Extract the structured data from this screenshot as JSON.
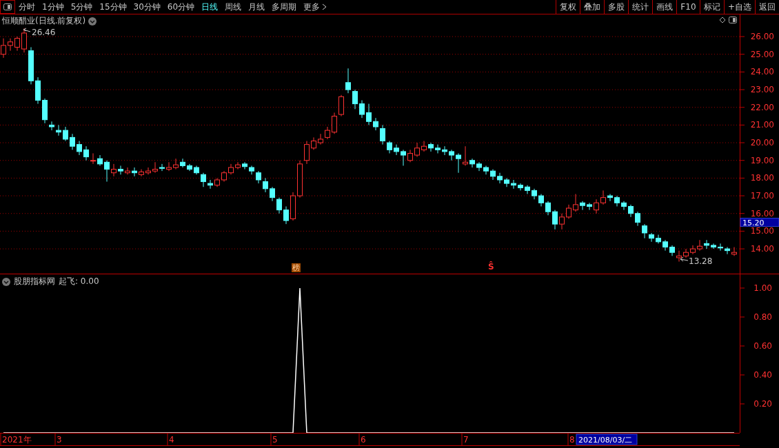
{
  "toolbar": {
    "periods": [
      {
        "label": "分时",
        "kind": "period",
        "selected": false
      },
      {
        "label": "1分钟",
        "kind": "period",
        "selected": false
      },
      {
        "label": "5分钟",
        "kind": "period",
        "selected": false
      },
      {
        "label": "15分钟",
        "kind": "period",
        "selected": false
      },
      {
        "label": "30分钟",
        "kind": "period",
        "selected": false
      },
      {
        "label": "60分钟",
        "kind": "period",
        "selected": false
      },
      {
        "label": "日线",
        "kind": "period",
        "selected": true
      },
      {
        "label": "周线",
        "kind": "period",
        "selected": false
      },
      {
        "label": "月线",
        "kind": "period",
        "selected": false
      },
      {
        "label": "多周期",
        "kind": "period",
        "selected": false
      },
      {
        "label": "更多",
        "kind": "menu",
        "selected": false
      }
    ],
    "actions": [
      "复权",
      "叠加",
      "多股",
      "统计",
      "画线",
      "F10",
      "标记",
      "+自选",
      "返回"
    ]
  },
  "price_pane": {
    "title": "恒顺醋业(日线.前复权)",
    "high_label": "26.46",
    "low_label": "13.28",
    "current_price": "15.20",
    "markers": [
      "榜",
      "Ŝ"
    ],
    "chart_data": {
      "type": "candlestick",
      "grid": true,
      "ylim": [
        12.6,
        27.25
      ],
      "yticks": [
        {
          "value": 26,
          "label": "26.00"
        },
        {
          "value": 25,
          "label": "25.00"
        },
        {
          "value": 24,
          "label": "24.00"
        },
        {
          "value": 23,
          "label": "23.00"
        },
        {
          "value": 22,
          "label": "22.00"
        },
        {
          "value": 21,
          "label": "21.00"
        },
        {
          "value": 20,
          "label": "20.00"
        },
        {
          "value": 19,
          "label": "19.00"
        },
        {
          "value": 18,
          "label": "18.00"
        },
        {
          "value": 17,
          "label": "17.00"
        },
        {
          "value": 16,
          "label": "16.00"
        },
        {
          "value": 15,
          "label": "15.00"
        },
        {
          "value": 14,
          "label": "14.00"
        }
      ],
      "categories": [
        null,
        null,
        null,
        null,
        null,
        null,
        null,
        null,
        null,
        null,
        null,
        null,
        null,
        null,
        null,
        null,
        null,
        null,
        null,
        null,
        null,
        null,
        null,
        null,
        null,
        null,
        null,
        null,
        null,
        null,
        null,
        null,
        null,
        null,
        null,
        null,
        null,
        null,
        null,
        null,
        null,
        null,
        null,
        null,
        null,
        null,
        null,
        null,
        null,
        null,
        null,
        null,
        null,
        null,
        null,
        null,
        null,
        null,
        null,
        null,
        null,
        null,
        null,
        null,
        null,
        null,
        null,
        null,
        null,
        null,
        null,
        null,
        null,
        null,
        null,
        null,
        null,
        null,
        null,
        null,
        null,
        null,
        null,
        null,
        null,
        null,
        null,
        null,
        null,
        null,
        null,
        null,
        null,
        null,
        null,
        null,
        null,
        null,
        null,
        null,
        null,
        null,
        null,
        null,
        null,
        null,
        null
      ],
      "ohlc": [
        [
          25.0,
          25.9,
          24.8,
          25.5
        ],
        [
          25.5,
          25.9,
          25.2,
          25.7
        ],
        [
          25.4,
          26.0,
          25.2,
          25.9
        ],
        [
          25.3,
          26.46,
          25.1,
          26.2
        ],
        [
          25.2,
          25.4,
          23.3,
          23.5
        ],
        [
          23.5,
          23.7,
          22.2,
          22.4
        ],
        [
          22.4,
          22.5,
          21.1,
          21.3
        ],
        [
          21.0,
          21.2,
          20.7,
          20.9
        ],
        [
          20.7,
          21.0,
          20.4,
          20.6
        ],
        [
          20.7,
          20.9,
          20.1,
          20.2
        ],
        [
          20.3,
          20.5,
          19.6,
          19.8
        ],
        [
          19.9,
          20.1,
          19.3,
          19.5
        ],
        [
          19.6,
          19.8,
          19.0,
          19.2
        ],
        [
          19.0,
          19.4,
          18.8,
          19.0
        ],
        [
          19.1,
          19.3,
          18.7,
          18.8
        ],
        [
          18.9,
          19.0,
          17.8,
          18.5
        ],
        [
          18.3,
          18.8,
          18.1,
          18.5
        ],
        [
          18.5,
          18.7,
          18.2,
          18.4
        ],
        [
          18.3,
          18.6,
          18.2,
          18.4
        ],
        [
          18.4,
          18.6,
          18.1,
          18.3
        ],
        [
          18.2,
          18.5,
          18.1,
          18.35
        ],
        [
          18.3,
          18.6,
          18.2,
          18.4
        ],
        [
          18.4,
          18.9,
          18.3,
          18.5
        ],
        [
          18.6,
          18.8,
          18.4,
          18.55
        ],
        [
          18.5,
          18.9,
          18.4,
          18.6
        ],
        [
          18.6,
          19.1,
          18.5,
          18.75
        ],
        [
          18.9,
          19.1,
          18.6,
          18.7
        ],
        [
          18.7,
          18.8,
          18.4,
          18.5
        ],
        [
          18.6,
          18.7,
          18.2,
          18.3
        ],
        [
          18.2,
          18.3,
          17.5,
          17.8
        ],
        [
          17.7,
          17.9,
          17.4,
          17.6
        ],
        [
          17.6,
          18.0,
          17.5,
          17.9
        ],
        [
          17.9,
          18.4,
          17.8,
          18.3
        ],
        [
          18.3,
          18.8,
          18.2,
          18.6
        ],
        [
          18.6,
          18.9,
          18.5,
          18.75
        ],
        [
          18.8,
          18.9,
          18.5,
          18.65
        ],
        [
          18.6,
          18.7,
          18.2,
          18.4
        ],
        [
          18.3,
          18.4,
          17.7,
          17.9
        ],
        [
          17.8,
          18.0,
          17.2,
          17.4
        ],
        [
          17.4,
          17.5,
          16.7,
          16.9
        ],
        [
          16.8,
          16.9,
          16.0,
          16.2
        ],
        [
          16.2,
          16.4,
          15.4,
          15.6
        ],
        [
          15.7,
          17.2,
          15.6,
          17.0
        ],
        [
          17.0,
          19.0,
          16.9,
          18.8
        ],
        [
          19.0,
          20.1,
          18.8,
          19.9
        ],
        [
          19.7,
          20.3,
          19.6,
          20.1
        ],
        [
          20.0,
          20.5,
          19.9,
          20.2
        ],
        [
          20.3,
          20.9,
          20.2,
          20.7
        ],
        [
          20.6,
          21.7,
          20.5,
          21.5
        ],
        [
          21.6,
          22.7,
          21.5,
          22.6
        ],
        [
          23.4,
          24.2,
          22.8,
          23.0
        ],
        [
          22.9,
          23.0,
          21.9,
          22.2
        ],
        [
          22.2,
          22.4,
          21.4,
          21.6
        ],
        [
          21.7,
          22.2,
          21.0,
          21.2
        ],
        [
          21.2,
          21.4,
          20.7,
          20.9
        ],
        [
          20.8,
          21.0,
          19.9,
          20.1
        ],
        [
          20.0,
          20.1,
          19.4,
          19.6
        ],
        [
          19.7,
          19.9,
          19.3,
          19.5
        ],
        [
          19.5,
          19.6,
          18.7,
          19.3
        ],
        [
          19.0,
          19.6,
          18.9,
          19.4
        ],
        [
          19.3,
          20.0,
          19.2,
          19.7
        ],
        [
          19.6,
          20.1,
          19.5,
          19.8
        ],
        [
          19.9,
          20.0,
          19.5,
          19.7
        ],
        [
          19.7,
          19.9,
          19.4,
          19.6
        ],
        [
          19.6,
          19.8,
          19.3,
          19.5
        ],
        [
          19.5,
          19.6,
          19.0,
          19.3
        ],
        [
          19.3,
          19.4,
          18.3,
          19.1
        ],
        [
          18.8,
          19.8,
          18.7,
          18.9
        ],
        [
          19.0,
          19.1,
          18.6,
          18.8
        ],
        [
          18.8,
          18.9,
          18.4,
          18.6
        ],
        [
          18.6,
          18.7,
          18.2,
          18.4
        ],
        [
          18.4,
          18.5,
          17.9,
          18.1
        ],
        [
          18.1,
          18.3,
          17.7,
          17.9
        ],
        [
          17.9,
          18.0,
          17.5,
          17.7
        ],
        [
          17.7,
          17.9,
          17.4,
          17.6
        ],
        [
          17.6,
          17.7,
          17.3,
          17.45
        ],
        [
          17.5,
          17.6,
          17.1,
          17.3
        ],
        [
          17.3,
          17.4,
          16.8,
          17.0
        ],
        [
          17.0,
          17.1,
          16.4,
          16.6
        ],
        [
          16.6,
          16.7,
          15.9,
          16.1
        ],
        [
          16.1,
          16.2,
          15.1,
          15.4
        ],
        [
          15.4,
          16.0,
          15.1,
          15.8
        ],
        [
          15.8,
          16.5,
          15.7,
          16.3
        ],
        [
          16.2,
          17.1,
          16.1,
          16.5
        ],
        [
          16.6,
          16.7,
          16.2,
          16.45
        ],
        [
          16.5,
          16.6,
          16.2,
          16.4
        ],
        [
          16.2,
          16.8,
          16.0,
          16.6
        ],
        [
          16.6,
          17.3,
          16.5,
          16.9
        ],
        [
          17.0,
          17.1,
          16.7,
          16.9
        ],
        [
          16.9,
          17.0,
          16.4,
          16.6
        ],
        [
          16.6,
          16.7,
          16.2,
          16.4
        ],
        [
          16.4,
          16.5,
          15.8,
          16.0
        ],
        [
          16.0,
          16.1,
          15.3,
          15.5
        ],
        [
          15.3,
          15.4,
          14.6,
          14.9
        ],
        [
          14.8,
          14.9,
          14.4,
          14.6
        ],
        [
          14.6,
          14.8,
          14.3,
          14.4
        ],
        [
          14.4,
          14.5,
          13.9,
          14.1
        ],
        [
          14.1,
          14.2,
          13.6,
          13.8
        ],
        [
          13.5,
          13.9,
          13.28,
          13.6
        ],
        [
          13.6,
          14.0,
          13.5,
          13.8
        ],
        [
          13.8,
          14.2,
          13.7,
          14.0
        ],
        [
          14.0,
          14.5,
          13.9,
          14.15
        ],
        [
          14.3,
          14.5,
          14.0,
          14.2
        ],
        [
          14.2,
          14.3,
          14.0,
          14.1
        ],
        [
          14.1,
          14.3,
          13.9,
          14.05
        ],
        [
          14.0,
          14.1,
          13.7,
          13.9
        ],
        [
          13.7,
          14.1,
          13.6,
          13.8
        ]
      ]
    }
  },
  "indicator_pane": {
    "name": "股朋指标网",
    "value_label": "起飞: 0.00",
    "chart_data": {
      "type": "line",
      "ylim": [
        0,
        1.095
      ],
      "yticks": [
        {
          "value": 1,
          "label": "1.00"
        },
        {
          "value": 0.8,
          "label": "0.80"
        },
        {
          "value": 0.6,
          "label": "0.60"
        },
        {
          "value": 0.4,
          "label": "0.40"
        },
        {
          "value": 0.2,
          "label": "0.20"
        }
      ],
      "categories": [
        null,
        null,
        null,
        null,
        null,
        null,
        null,
        null,
        null,
        null,
        null,
        null,
        null,
        null,
        null,
        null,
        null,
        null,
        null,
        null,
        null,
        null,
        null,
        null,
        null,
        null,
        null,
        null,
        null,
        null,
        null,
        null,
        null,
        null,
        null,
        null,
        null,
        null,
        null,
        null,
        null,
        null,
        null,
        null,
        null,
        null,
        null,
        null,
        null,
        null,
        null,
        null,
        null,
        null,
        null,
        null,
        null,
        null,
        null,
        null,
        null,
        null,
        null,
        null,
        null,
        null,
        null,
        null,
        null,
        null,
        null,
        null,
        null,
        null,
        null,
        null,
        null,
        null,
        null,
        null,
        null,
        null,
        null,
        null,
        null,
        null,
        null,
        null,
        null,
        null,
        null,
        null,
        null,
        null,
        null,
        null,
        null,
        null,
        null,
        null,
        null,
        null,
        null,
        null,
        null,
        null,
        null
      ],
      "series": [
        {
          "color": "#ffffff",
          "values": [
            0,
            0,
            0,
            0,
            0,
            0,
            0,
            0,
            0,
            0,
            0,
            0,
            0,
            0,
            0,
            0,
            0,
            0,
            0,
            0,
            0,
            0,
            0,
            0,
            0,
            0,
            0,
            0,
            0,
            0,
            0,
            0,
            0,
            0,
            0,
            0,
            0,
            0,
            0,
            0,
            0,
            0,
            0,
            1,
            0,
            0,
            0,
            0,
            0,
            0,
            0,
            0,
            0,
            0,
            0,
            0,
            0,
            0,
            0,
            0,
            0,
            0,
            0,
            0,
            0,
            0,
            0,
            0,
            0,
            0,
            0,
            0,
            0,
            0,
            0,
            0,
            0,
            0,
            0,
            0,
            0,
            0,
            0,
            0,
            0,
            0,
            0,
            0,
            0,
            0,
            0,
            0,
            0,
            0,
            0,
            0,
            0,
            0,
            0,
            0,
            0,
            0,
            0,
            0,
            0,
            0,
            0
          ]
        }
      ]
    }
  },
  "time_axis": {
    "labels": [
      "2021年",
      "3",
      "4",
      "5",
      "6",
      "7",
      "8"
    ],
    "cursor_date": "2021/08/03/二"
  }
}
